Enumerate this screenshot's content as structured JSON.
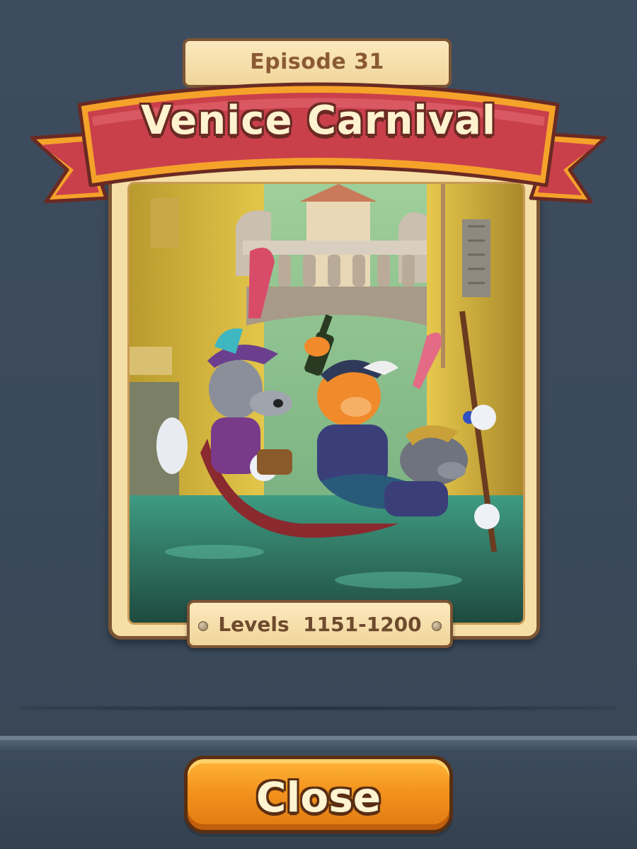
{
  "episode": {
    "label": "Episode 31"
  },
  "title": {
    "text": "Venice Carnival"
  },
  "levels": {
    "text": "Levels  1151-1200"
  },
  "actions": {
    "close_label": "Close"
  },
  "colors": {
    "background": "#3b4a5c",
    "ribbon_red": "#c9404b",
    "ribbon_orange": "#f5a22a",
    "plate_cream": "#f6dfa6",
    "frame_brown": "#7a5534",
    "button_orange": "#f3931d"
  }
}
